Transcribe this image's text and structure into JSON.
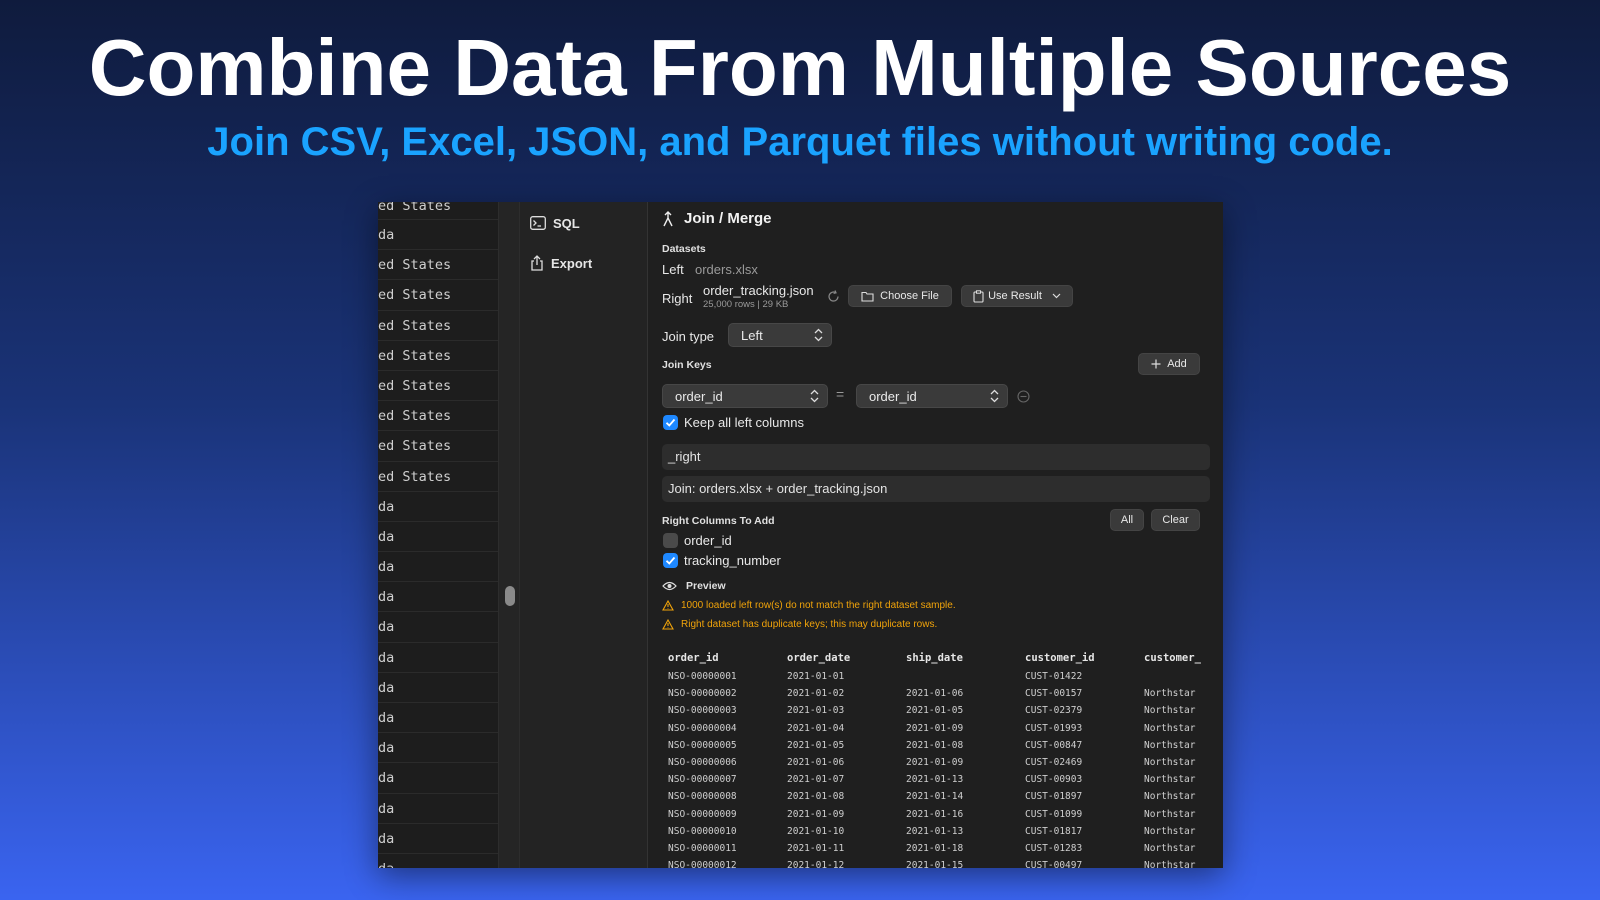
{
  "hero": {
    "title": "Combine Data From Multiple Sources",
    "subtitle": "Join CSV, Excel, JSON, and Parquet files without writing code."
  },
  "left_strip": {
    "rows": [
      "ed States",
      "da",
      "ed States",
      "ed States",
      "ed States",
      "ed States",
      "ed States",
      "ed States",
      "ed States",
      "ed States",
      "da",
      "da",
      "da",
      "da",
      "da",
      "da",
      "da",
      "da",
      "da",
      "da",
      "da",
      "da",
      "da"
    ]
  },
  "nav": {
    "items": [
      {
        "label": "SQL",
        "icon": "terminal-icon"
      },
      {
        "label": "Export",
        "icon": "share-icon"
      }
    ]
  },
  "panel": {
    "title": "Join / Merge",
    "datasets_label": "Datasets",
    "left_label": "Left",
    "left_file": "orders.xlsx",
    "right_label": "Right",
    "right_file": "order_tracking.json",
    "right_meta": "25,000 rows | 29 KB",
    "choose_file": "Choose File",
    "use_result": "Use Result",
    "join_type_label": "Join type",
    "join_type_value": "Left",
    "join_keys_label": "Join Keys",
    "add_label": "Add",
    "left_key": "order_id",
    "equals": "=",
    "right_key": "order_id",
    "keep_all_label": "Keep all left columns",
    "keep_all_checked": true,
    "suffix_value": "_right",
    "result_name_value": "Join: orders.xlsx + order_tracking.json",
    "right_columns_label": "Right Columns To Add",
    "all_label": "All",
    "clear_label": "Clear",
    "right_columns": [
      {
        "name": "order_id",
        "checked": false
      },
      {
        "name": "tracking_number",
        "checked": true
      }
    ],
    "preview_label": "Preview",
    "warnings": [
      "1000 loaded left row(s) do not match the right dataset sample.",
      "Right dataset has duplicate keys; this may duplicate rows."
    ],
    "accent_color": "#1e88ff",
    "warning_color": "#f0a30a"
  },
  "preview_table": {
    "headers": [
      "order_id",
      "order_date",
      "ship_date",
      "customer_id",
      "customer_"
    ],
    "rows": [
      [
        "NSO-00000001",
        "2021-01-01",
        "",
        "CUST-01422",
        ""
      ],
      [
        "NSO-00000002",
        "2021-01-02",
        "2021-01-06",
        "CUST-00157",
        "Northstar"
      ],
      [
        "NSO-00000003",
        "2021-01-03",
        "2021-01-05",
        "CUST-02379",
        "Northstar"
      ],
      [
        "NSO-00000004",
        "2021-01-04",
        "2021-01-09",
        "CUST-01993",
        "Northstar"
      ],
      [
        "NSO-00000005",
        "2021-01-05",
        "2021-01-08",
        "CUST-00847",
        "Northstar"
      ],
      [
        "NSO-00000006",
        "2021-01-06",
        "2021-01-09",
        "CUST-02469",
        "Northstar"
      ],
      [
        "NSO-00000007",
        "2021-01-07",
        "2021-01-13",
        "CUST-00903",
        "Northstar"
      ],
      [
        "NSO-00000008",
        "2021-01-08",
        "2021-01-14",
        "CUST-01897",
        "Northstar"
      ],
      [
        "NSO-00000009",
        "2021-01-09",
        "2021-01-16",
        "CUST-01099",
        "Northstar"
      ],
      [
        "NSO-00000010",
        "2021-01-10",
        "2021-01-13",
        "CUST-01817",
        "Northstar"
      ],
      [
        "NSO-00000011",
        "2021-01-11",
        "2021-01-18",
        "CUST-01283",
        "Northstar"
      ],
      [
        "NSO-00000012",
        "2021-01-12",
        "2021-01-15",
        "CUST-00497",
        "Northstar"
      ]
    ]
  }
}
